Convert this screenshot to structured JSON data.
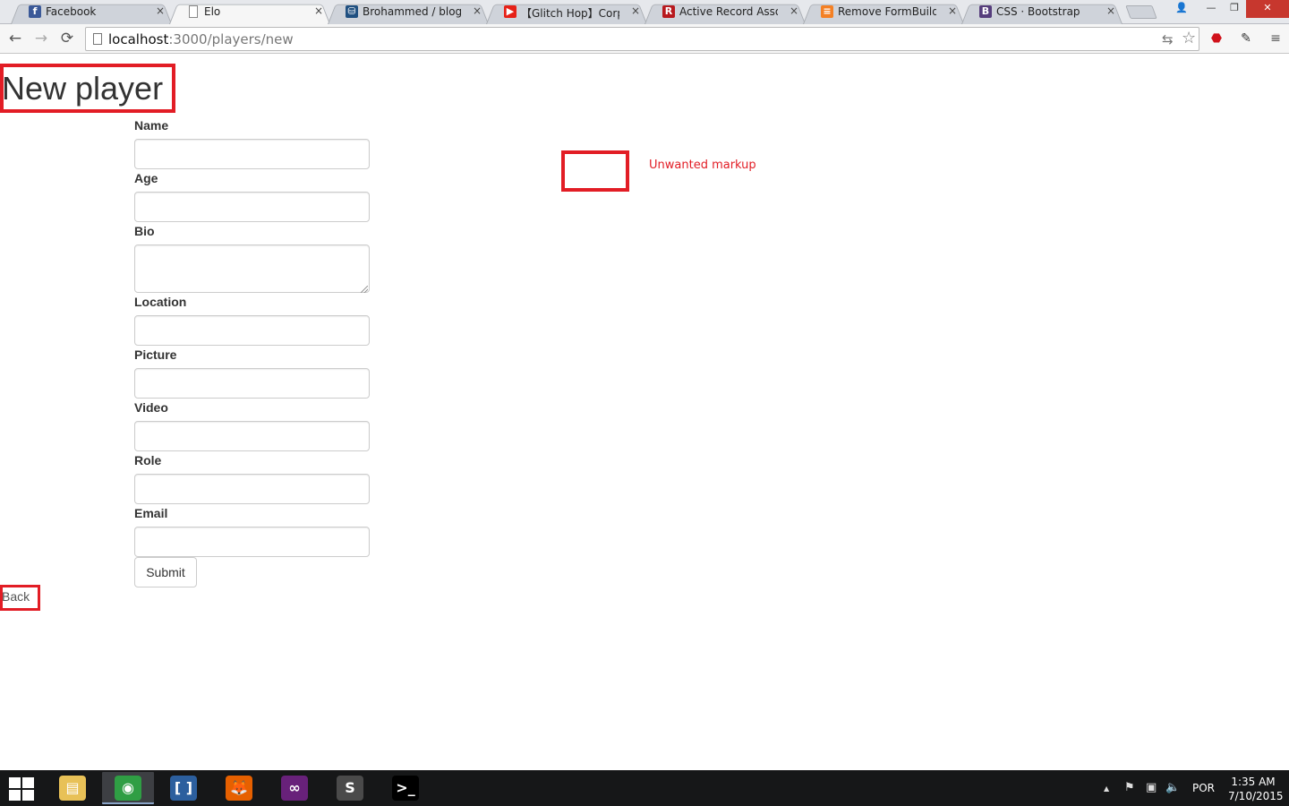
{
  "browser": {
    "tabs": [
      {
        "title": "Facebook",
        "favicon": "facebook-icon",
        "color": "#3b5998",
        "glyph": "f"
      },
      {
        "title": "Elo",
        "favicon": "page-icon",
        "color": "#ffffff",
        "glyph": ""
      },
      {
        "title": "Brohammed / blog — B",
        "favicon": "bitbucket-icon",
        "color": "#205081",
        "glyph": "⛁"
      },
      {
        "title": "【Glitch Hop】Corporat",
        "favicon": "youtube-icon",
        "color": "#e62117",
        "glyph": "▶"
      },
      {
        "title": "Active Record Associati",
        "favicon": "rails-icon",
        "color": "#b8191e",
        "glyph": "R"
      },
      {
        "title": "Remove FormBuilder ht",
        "favicon": "stackoverflow-icon",
        "color": "#f48024",
        "glyph": "≡"
      },
      {
        "title": "CSS · Bootstrap",
        "favicon": "bootstrap-icon",
        "color": "#563d7c",
        "glyph": "B"
      }
    ],
    "close_glyph": "×",
    "window_controls": {
      "user": "👤",
      "minimize": "—",
      "maximize": "❐",
      "close": "✕"
    },
    "nav": {
      "back": "←",
      "forward": "→",
      "reload": "⟳"
    },
    "url_host": "localhost",
    "url_path": ":3000/players/new",
    "omnibox_icons": {
      "translate": "⇆",
      "bookmark": "☆"
    },
    "extensions": [
      {
        "name": "adblock-icon",
        "glyph": "⬣",
        "color": "#d0121b"
      },
      {
        "name": "evernote-icon",
        "glyph": "✎",
        "color": "#333333"
      },
      {
        "name": "chrome-menu-icon",
        "glyph": "≡",
        "color": "#555555"
      }
    ]
  },
  "page": {
    "title": "New player",
    "fields": [
      {
        "label": "Name",
        "value": ""
      },
      {
        "label": "Age",
        "value": ""
      },
      {
        "label": "Bio",
        "value": ""
      },
      {
        "label": "Location",
        "value": ""
      },
      {
        "label": "Picture",
        "value": ""
      },
      {
        "label": "Video",
        "value": ""
      },
      {
        "label": "Role",
        "value": ""
      },
      {
        "label": "Email",
        "value": ""
      }
    ],
    "submit_label": "Submit",
    "back_label": "Back",
    "annotation_label": "Unwanted markup",
    "annotation_color": "#e21d25"
  },
  "taskbar": {
    "apps": [
      {
        "name": "file-explorer-icon",
        "glyph": "▤",
        "color": "#e8c157",
        "active": false
      },
      {
        "name": "chrome-icon",
        "glyph": "◉",
        "color": "#2f9e44",
        "active": true
      },
      {
        "name": "brackets-icon",
        "glyph": "[ ]",
        "color": "#2c5f9e",
        "active": false
      },
      {
        "name": "firefox-icon",
        "glyph": "🦊",
        "color": "#e66000",
        "active": false
      },
      {
        "name": "visual-studio-icon",
        "glyph": "∞",
        "color": "#68217a",
        "active": false
      },
      {
        "name": "sublime-text-icon",
        "glyph": "S",
        "color": "#4a4a4a",
        "active": false
      },
      {
        "name": "command-prompt-icon",
        "glyph": ">_",
        "color": "#000000",
        "active": false
      }
    ],
    "tray_icons": {
      "up_arrow": "▲",
      "flag": "⚑",
      "network": "▣",
      "volume": "🔈"
    },
    "language": "POR",
    "time": "1:35 AM",
    "date": "7/10/2015"
  }
}
